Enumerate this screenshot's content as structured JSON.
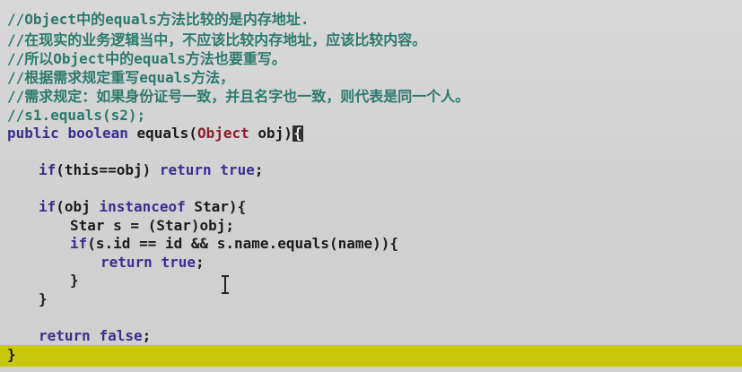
{
  "editor": {
    "comments": [
      "//Object中的equals方法比较的是内存地址.",
      "//在现实的业务逻辑当中，不应该比较内存地址，应该比较内容。",
      "//所以Object中的equals方法也要重写。",
      "//根据需求规定重写equals方法，",
      "//需求规定：如果身份证号一致，并且名字也一致，则代表是同一个人。",
      "//s1.equals(s2);"
    ],
    "method": {
      "public_kw": "public",
      "boolean_kw": "boolean",
      "name": "equals(",
      "param_type": "Object",
      "param_rest": " obj)",
      "open_brace": "{"
    },
    "if_this": {
      "if_kw": "if",
      "cond": "(this==obj) ",
      "return_kw": "return",
      "true_kw": "true",
      "end": ";"
    },
    "if_instance": {
      "if_kw": "if",
      "before": "(obj ",
      "instanceof_kw": "instanceof",
      "after": " Star){"
    },
    "cast_line": "Star s = (Star)obj;",
    "if_compare": {
      "if_kw": "if",
      "cond": "(s.id == id && s.name.equals(name)){"
    },
    "return_true": {
      "return_kw": "return",
      "true_kw": "true",
      "end": ";"
    },
    "inner_close": "}",
    "outer_close": "}",
    "return_false": {
      "return_kw": "return",
      "false_kw": "false",
      "end": ";"
    },
    "method_close": "}"
  },
  "colors": {
    "background": "#d3d3d3",
    "comment": "#2b7a6d",
    "keyword": "#3a2f8f",
    "type": "#8b1c2a",
    "current_line_highlight": "#c9c70f"
  },
  "icons": {
    "text_cursor": "i-beam-cursor-icon"
  }
}
